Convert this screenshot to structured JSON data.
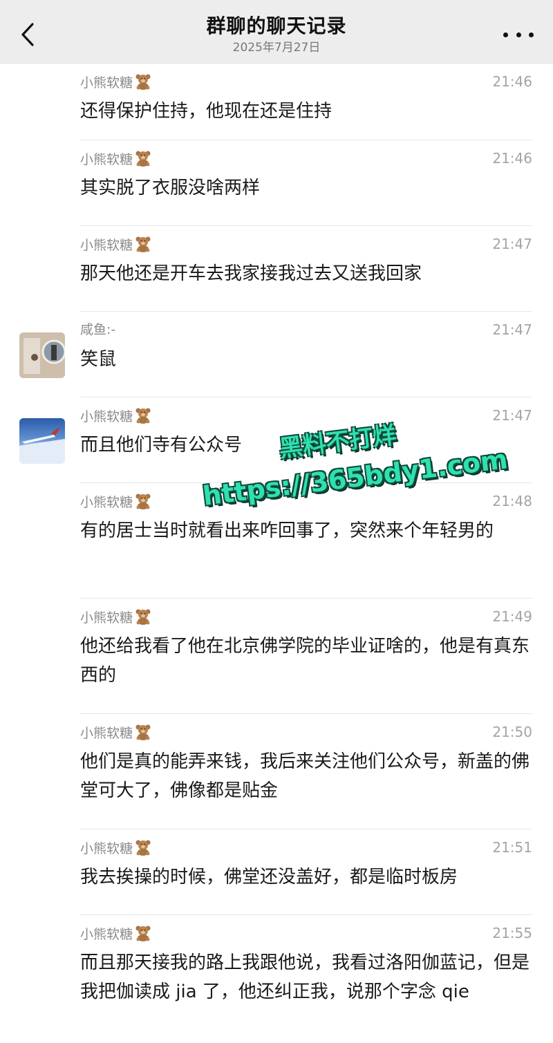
{
  "header": {
    "title": "群聊的聊天记录",
    "date": "2025年7月27日"
  },
  "icons": {
    "back": "chevron-left-icon",
    "more": "more-dots-icon",
    "sender_badge": "teddy-bear-emoji"
  },
  "messages": [
    {
      "sender": "小熊软糖",
      "time": "21:46",
      "text": "还得保护住持，他现在还是住持",
      "avatar": ""
    },
    {
      "sender": "小熊软糖",
      "time": "21:46",
      "text": "其实脱了衣服没啥两样",
      "avatar": ""
    },
    {
      "sender": "小熊软糖",
      "time": "21:47",
      "text": "那天他还是开车去我家接我过去又送我回家",
      "avatar": ""
    },
    {
      "sender": "咸鱼:-",
      "time": "21:47",
      "text": "笑鼠",
      "avatar": "room"
    },
    {
      "sender": "小熊软糖",
      "time": "21:47",
      "text": "而且他们寺有公众号",
      "avatar": "sky"
    },
    {
      "sender": "小熊软糖",
      "time": "21:48",
      "text": "有的居士当时就看出来咋回事了，突然来个年轻男的",
      "avatar": ""
    },
    {
      "sender": "小熊软糖",
      "time": "21:49",
      "text": "他还给我看了他在北京佛学院的毕业证啥的，他是有真东西的",
      "avatar": ""
    },
    {
      "sender": "小熊软糖",
      "time": "21:50",
      "text": "他们是真的能弄来钱，我后来关注他们公众号，新盖的佛堂可大了，佛像都是贴金",
      "avatar": ""
    },
    {
      "sender": "小熊软糖",
      "time": "21:51",
      "text": "我去挨操的时候，佛堂还没盖好，都是临时板房",
      "avatar": ""
    },
    {
      "sender": "小熊软糖",
      "time": "21:55",
      "text": "而且那天接我的路上我跟他说，我看过洛阳伽蓝记，但是我把伽读成 jia 了，他还纠正我，说那个字念 qie",
      "avatar": ""
    }
  ],
  "watermark": {
    "line1": "黑料不打烊",
    "line2": "https://365bdy1.com",
    "color": "#2fe0b0"
  }
}
